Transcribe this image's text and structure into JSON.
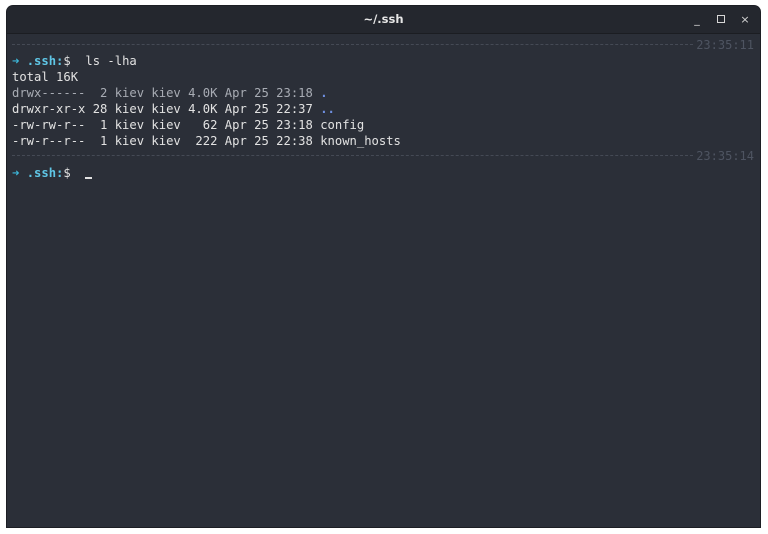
{
  "window": {
    "title": "~/.ssh",
    "minimize_label": "_",
    "close_label": "×"
  },
  "terminal": {
    "prompt_arrow": "➜",
    "prompt_dir": ".ssh:",
    "prompt_symbol": "$",
    "first_timestamp": "23:35:11",
    "command": "ls -lha",
    "total": "total 16K",
    "rows": [
      {
        "meta": "drwx------  2 kiev kiev 4.0K Apr 25 23:18 ",
        "name": ".",
        "kind": "dir"
      },
      {
        "meta": "drwxr-xr-x 28 kiev kiev 4.0K Apr 25 22:37 ",
        "name": "..",
        "kind": "dir"
      },
      {
        "meta": "-rw-rw-r--  1 kiev kiev   62 Apr 25 23:18 ",
        "name": "config",
        "kind": "file"
      },
      {
        "meta": "-rw-r--r--  1 kiev kiev  222 Apr 25 22:38 ",
        "name": "known_hosts",
        "kind": "file"
      }
    ],
    "second_timestamp": "23:35:14"
  },
  "colors": {
    "background": "#2b2f38",
    "titlebar": "#24272e",
    "prompt_accent": "#5fc6e6",
    "dir_entry": "#6f8fe0"
  }
}
